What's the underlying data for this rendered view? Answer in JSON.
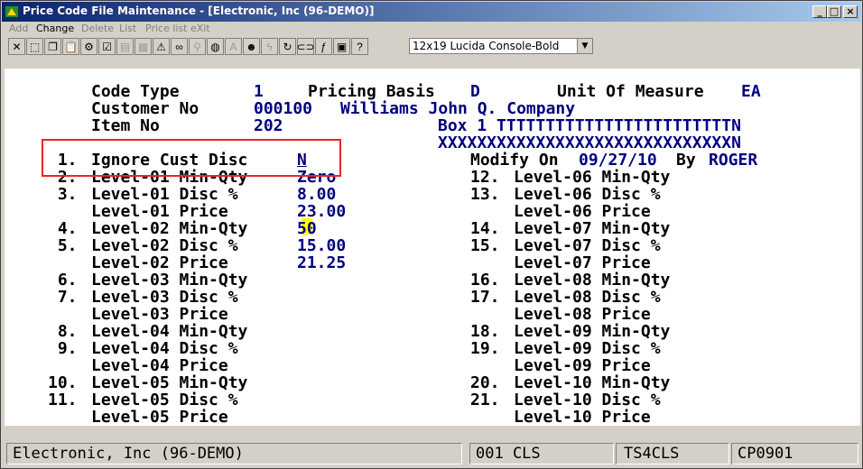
{
  "window": {
    "title": "Price Code File Maintenance - [Electronic, Inc (96-DEMO)]",
    "controls": {
      "minimize": "_",
      "restore": "□",
      "close": "×"
    }
  },
  "menu": [
    {
      "label": "Add",
      "enabled": false
    },
    {
      "label": "Change",
      "enabled": true
    },
    {
      "label": "Delete",
      "enabled": false
    },
    {
      "label": "List",
      "enabled": false
    },
    {
      "label": "Price list",
      "enabled": false
    },
    {
      "label": "eXit",
      "enabled": false
    }
  ],
  "toolbar": {
    "icons": [
      "close-x-icon",
      "select-icon",
      "copy-icon",
      "paste-icon",
      "settings-icon",
      "properties-icon",
      "notes-icon",
      "print-icon",
      "alert-icon",
      "binoculars-icon",
      "zoom-icon",
      "globe-icon",
      "font-icon",
      "user-icon",
      "lightning-icon",
      "refresh-icon",
      "link-icon",
      "function-icon",
      "calculator-icon",
      "help-icon"
    ],
    "font_select": "12x19 Lucida Console-Bold"
  },
  "header": {
    "code_type_label": "Code Type",
    "code_type_value": "1",
    "pricing_basis_label": "Pricing Basis",
    "pricing_basis_value": "D",
    "uom_label": "Unit Of Measure",
    "uom_value": "EA",
    "customer_label": "Customer No",
    "customer_value": "000100",
    "customer_name": "Williams John Q. Company",
    "item_label": "Item No",
    "item_value": "202",
    "item_desc1": "Box 1 TTTTTTTTTTTTTTTTTTTTTTTTN",
    "item_desc2": "XXXXXXXXXXXXXXXXXXXXXXXXXXXXXXN",
    "modify_label": "Modify On",
    "modify_date": "09/27/10",
    "by_label": "By",
    "modify_user": "ROGER"
  },
  "left_fields": [
    {
      "num": " 1.",
      "label": "Ignore Cust Disc",
      "value": "N"
    },
    {
      "num": " 2.",
      "label": "Level-01 Min-Qty",
      "value": "Zero"
    },
    {
      "num": " 3.",
      "label": "Level-01 Disc %",
      "value": "8.00"
    },
    {
      "num": "",
      "label": "Level-01 Price",
      "value": "23.00"
    },
    {
      "num": " 4.",
      "label": "Level-02 Min-Qty",
      "value": "50"
    },
    {
      "num": " 5.",
      "label": "Level-02 Disc %",
      "value": "15.00"
    },
    {
      "num": "",
      "label": "Level-02 Price",
      "value": "21.25"
    },
    {
      "num": " 6.",
      "label": "Level-03 Min-Qty",
      "value": ""
    },
    {
      "num": " 7.",
      "label": "Level-03 Disc %",
      "value": ""
    },
    {
      "num": "",
      "label": "Level-03 Price",
      "value": ""
    },
    {
      "num": " 8.",
      "label": "Level-04 Min-Qty",
      "value": ""
    },
    {
      "num": " 9.",
      "label": "Level-04 Disc %",
      "value": ""
    },
    {
      "num": "",
      "label": "Level-04 Price",
      "value": ""
    },
    {
      "num": "10.",
      "label": "Level-05 Min-Qty",
      "value": ""
    },
    {
      "num": "11.",
      "label": "Level-05 Disc %",
      "value": ""
    },
    {
      "num": "",
      "label": "Level-05 Price",
      "value": ""
    }
  ],
  "right_fields": [
    {
      "num": "12.",
      "label": "Level-06 Min-Qty"
    },
    {
      "num": "13.",
      "label": "Level-06 Disc %"
    },
    {
      "num": "",
      "label": "Level-06 Price"
    },
    {
      "num": "14.",
      "label": "Level-07 Min-Qty"
    },
    {
      "num": "15.",
      "label": "Level-07 Disc %"
    },
    {
      "num": "",
      "label": "Level-07 Price"
    },
    {
      "num": "16.",
      "label": "Level-08 Min-Qty"
    },
    {
      "num": "17.",
      "label": "Level-08 Disc %"
    },
    {
      "num": "",
      "label": "Level-08 Price"
    },
    {
      "num": "18.",
      "label": "Level-09 Min-Qty"
    },
    {
      "num": "19.",
      "label": "Level-09 Disc %"
    },
    {
      "num": "",
      "label": "Level-09 Price"
    },
    {
      "num": "20.",
      "label": "Level-10 Min-Qty"
    },
    {
      "num": "21.",
      "label": "Level-10 Disc %"
    },
    {
      "num": "",
      "label": "Level-10 Price"
    }
  ],
  "status": {
    "company": "Electronic, Inc (96-DEMO)",
    "cls": "001 CLS",
    "terminal": "TS4CLS",
    "program": "CP0901"
  },
  "colors": {
    "label": "#000000",
    "value": "#000080",
    "highlight": "#e8262a",
    "cursor": "#ffff00"
  }
}
